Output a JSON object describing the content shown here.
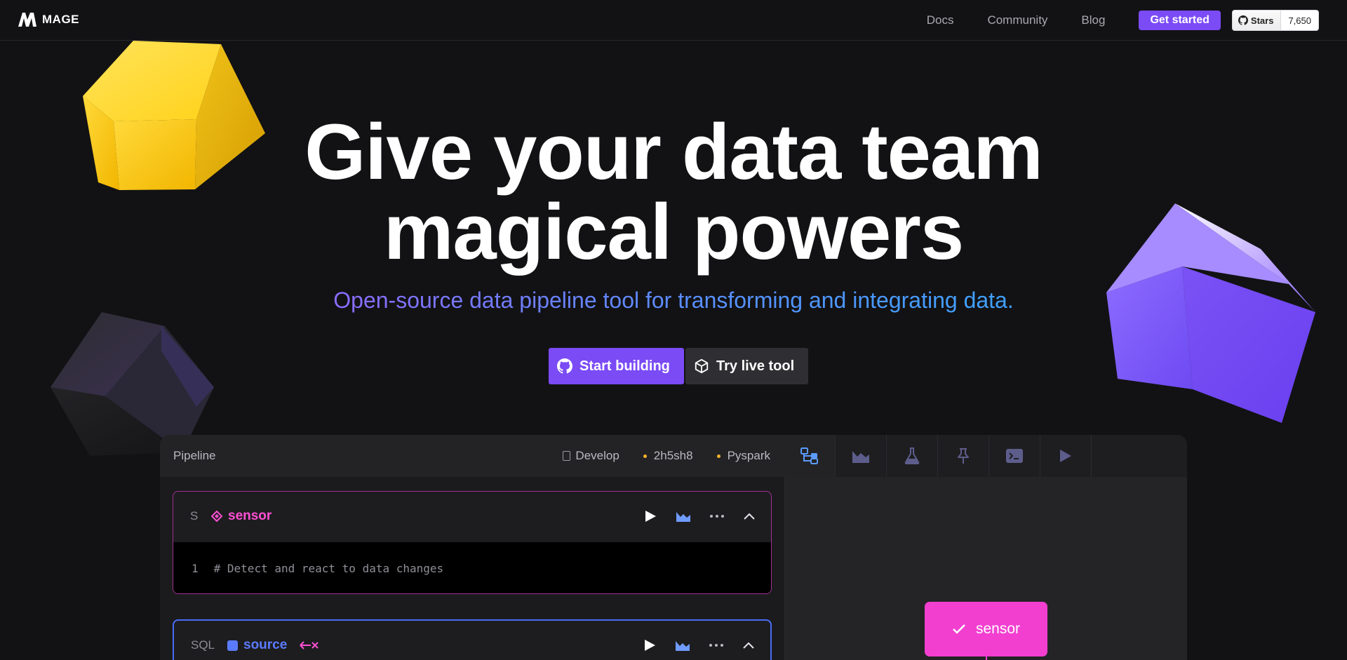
{
  "nav": {
    "logo_text": "MAGE",
    "links": [
      "Docs",
      "Community",
      "Blog"
    ],
    "get_started": "Get started",
    "github": {
      "stars_label": "Stars",
      "stars_count": "7,650"
    }
  },
  "hero": {
    "title_line1": "Give your data team",
    "title_line2": "magical powers",
    "subtitle": "Open-source data pipeline tool for transforming and integrating data.",
    "cta_primary": "Start building",
    "cta_secondary": "Try live tool"
  },
  "pipeline": {
    "title": "Pipeline",
    "meta": {
      "mode": "Develop",
      "id": "2h5sh8",
      "engine": "Pyspark"
    },
    "tabs": [
      "dependency-tree",
      "chart",
      "flask",
      "pin",
      "terminal",
      "play"
    ],
    "blocks": [
      {
        "letter": "S",
        "name": "sensor",
        "code_line_no": "1",
        "code": "# Detect and react to data changes",
        "color": "#ff4fd3"
      },
      {
        "letter": "SQL",
        "name": "source",
        "color": "#5b7bff"
      }
    ],
    "node": {
      "label": "sensor",
      "color": "#f23fd0"
    }
  },
  "colors": {
    "accent": "#7b4bf6",
    "sensor": "#ff4fd3",
    "source": "#5b7bff",
    "background": "#121214"
  }
}
